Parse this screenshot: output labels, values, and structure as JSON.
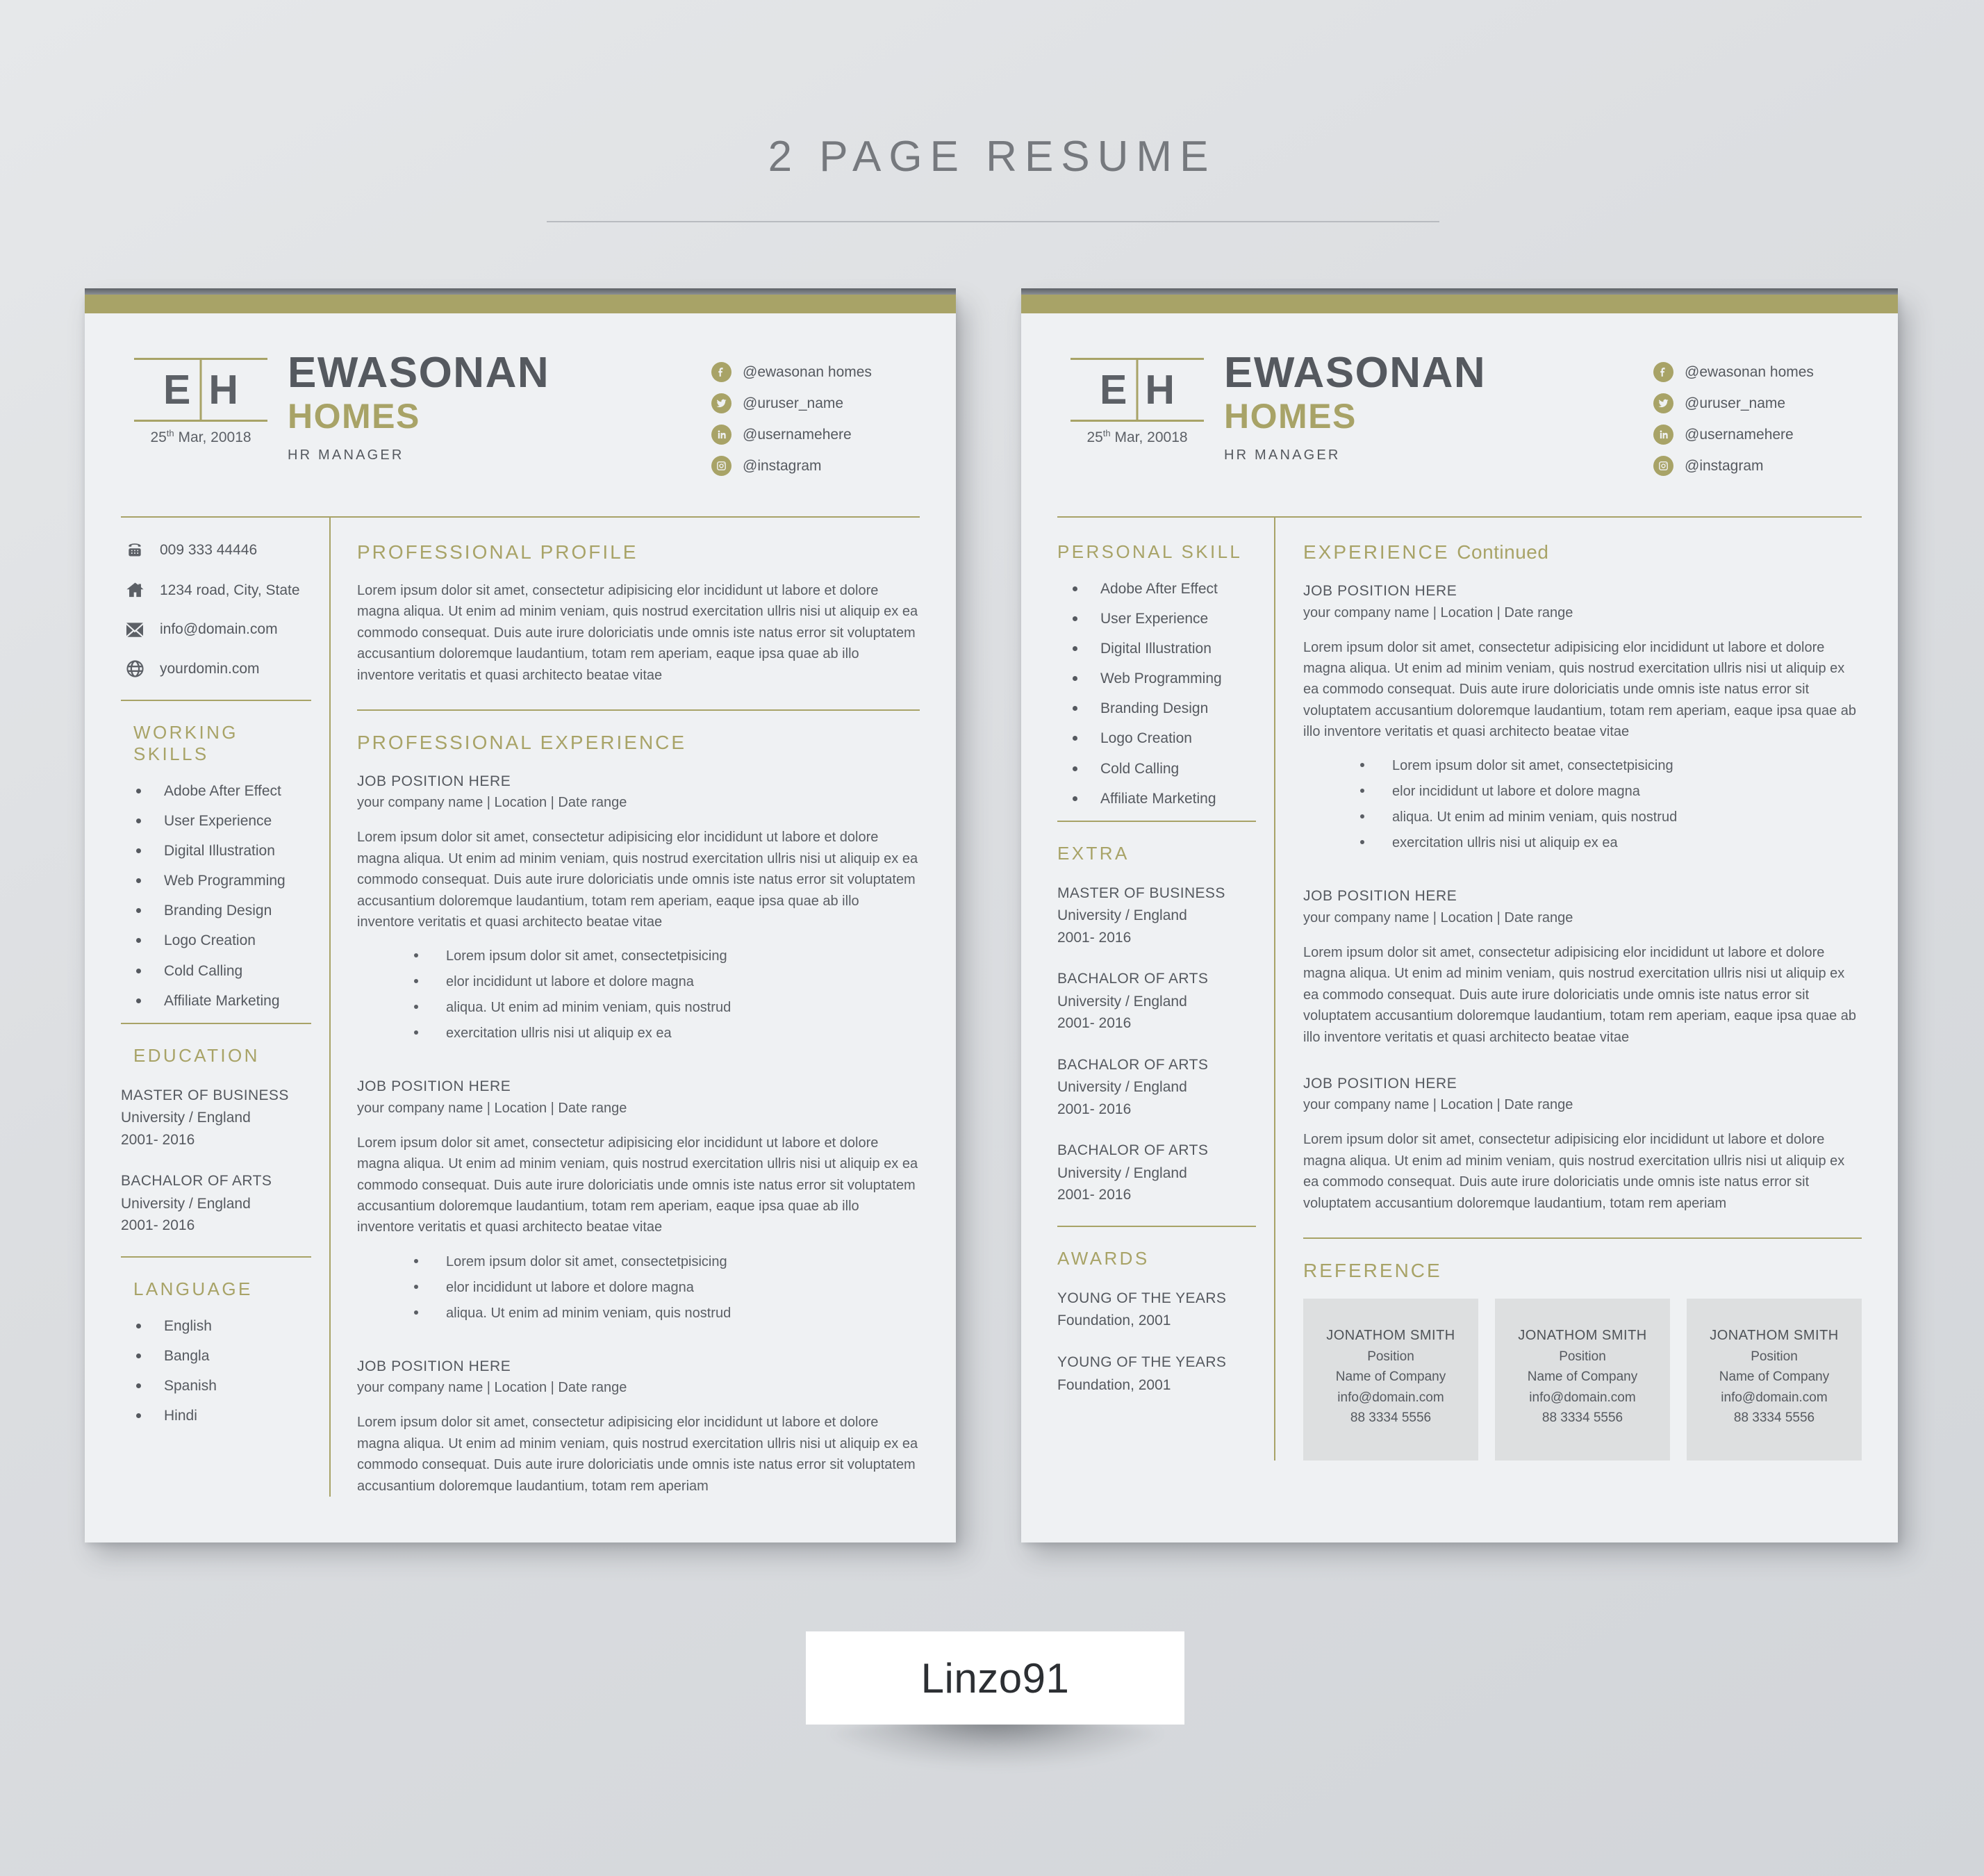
{
  "header": {
    "title": "2 PAGE RESUME"
  },
  "badge": {
    "label": "Linzo91"
  },
  "colors": {
    "accent": "#a8a367",
    "ink": "#55595f",
    "paper": "#eff1f3",
    "card": "#dddfe0"
  },
  "identity": {
    "monogram_left": "E",
    "monogram_right": "H",
    "date_day": "25",
    "date_sup": "th",
    "date_rest": " Mar, 20018",
    "first_name": "EWASONAN",
    "last_name": "HOMES",
    "role": "HR MANAGER"
  },
  "social": [
    {
      "icon": "facebook-icon",
      "handle": "@ewasonan homes"
    },
    {
      "icon": "twitter-icon",
      "handle": "@uruser_name"
    },
    {
      "icon": "linkedin-icon",
      "handle": "@usernamehere"
    },
    {
      "icon": "instagram-icon",
      "handle": "@instagram"
    }
  ],
  "contact": [
    {
      "icon": "phone-icon",
      "value": "009 333 44446"
    },
    {
      "icon": "home-icon",
      "value": "1234 road, City, State"
    },
    {
      "icon": "email-icon",
      "value": "info@domain.com"
    },
    {
      "icon": "globe-icon",
      "value": "yourdomin.com"
    }
  ],
  "page1": {
    "working_skills": {
      "heading": "WORKING SKILLS",
      "items": [
        "Adobe After Effect",
        "User Experience",
        "Digital Illustration",
        "Web Programming",
        "Branding Design",
        "Logo Creation",
        "Cold Calling",
        "Affiliate Marketing"
      ]
    },
    "education": {
      "heading": "EDUCATION",
      "items": [
        {
          "degree": "MASTER OF BUSINESS",
          "school": "University / England",
          "years": "2001- 2016"
        },
        {
          "degree": "BACHALOR OF ARTS",
          "school": "University / England",
          "years": "2001- 2016"
        }
      ]
    },
    "language": {
      "heading": "LANGUAGE",
      "items": [
        "English",
        "Bangla",
        "Spanish",
        "Hindi"
      ]
    },
    "profile": {
      "heading": "PROFESSIONAL PROFILE",
      "body": "Lorem ipsum dolor sit amet, consectetur adipisicing elor incididunt ut labore et dolore magna aliqua. Ut enim ad minim veniam, quis nostrud exercitation ullris nisi ut aliquip ex ea commodo consequat. Duis aute irure doloriciatis unde omnis iste natus error sit voluptatem accusantium doloremque laudantium, totam rem aperiam, eaque ipsa quae ab illo inventore veritatis et quasi architecto beatae vitae"
    },
    "experience": {
      "heading": "PROFESSIONAL EXPERIENCE",
      "jobs": [
        {
          "title": "JOB POSITION HERE",
          "meta": "your company name | Location | Date range",
          "body": "Lorem ipsum dolor sit amet, consectetur adipisicing elor incididunt ut labore et dolore magna aliqua. Ut enim ad minim veniam, quis nostrud exercitation ullris nisi ut aliquip ex ea commodo consequat. Duis aute irure doloriciatis unde omnis iste natus error sit voluptatem accusantium doloremque laudantium, totam rem aperiam, eaque ipsa quae ab illo inventore veritatis et quasi architecto beatae vitae",
          "bullets": [
            "Lorem ipsum dolor sit amet, consectetpisicing",
            "elor incididunt ut labore et dolore magna",
            "aliqua. Ut enim ad minim veniam, quis nostrud",
            "exercitation ullris nisi ut aliquip ex ea"
          ]
        },
        {
          "title": "JOB POSITION HERE",
          "meta": "your company name | Location | Date range",
          "body": "Lorem ipsum dolor sit amet, consectetur adipisicing elor incididunt ut labore et dolore magna aliqua. Ut enim ad minim veniam, quis nostrud exercitation ullris nisi ut aliquip ex ea commodo consequat. Duis aute irure doloriciatis unde omnis iste natus error sit voluptatem accusantium doloremque laudantium, totam rem aperiam, eaque ipsa quae ab illo inventore veritatis et quasi architecto beatae vitae",
          "bullets": [
            "Lorem ipsum dolor sit amet, consectetpisicing",
            "elor incididunt ut labore et dolore magna",
            "aliqua. Ut enim ad minim veniam, quis nostrud"
          ]
        },
        {
          "title": "JOB POSITION HERE",
          "meta": "your company name | Location | Date range",
          "body": "Lorem ipsum dolor sit amet, consectetur adipisicing elor incididunt ut labore et dolore magna aliqua. Ut enim ad minim veniam, quis nostrud exercitation ullris nisi ut aliquip ex ea commodo consequat. Duis aute irure doloriciatis unde omnis iste natus error sit voluptatem accusantium doloremque laudantium, totam rem aperiam",
          "bullets": []
        }
      ]
    }
  },
  "page2": {
    "personal_skill": {
      "heading": "PERSONAL SKILL",
      "items": [
        "Adobe After Effect",
        "User Experience",
        "Digital Illustration",
        "Web Programming",
        "Branding Design",
        "Logo Creation",
        "Cold Calling",
        "Affiliate Marketing"
      ]
    },
    "extra": {
      "heading": "EXTRA",
      "items": [
        {
          "degree": "MASTER OF BUSINESS",
          "school": "University / England",
          "years": "2001- 2016"
        },
        {
          "degree": "BACHALOR OF ARTS",
          "school": "University / England",
          "years": "2001- 2016"
        },
        {
          "degree": "BACHALOR OF ARTS",
          "school": "University / England",
          "years": "2001- 2016"
        },
        {
          "degree": "BACHALOR OF ARTS",
          "school": "University / England",
          "years": "2001- 2016"
        }
      ]
    },
    "awards": {
      "heading": "AWARDS",
      "items": [
        {
          "name": "YOUNG OF THE YEARS",
          "org": "Foundation, 2001"
        },
        {
          "name": "YOUNG OF THE YEARS",
          "org": "Foundation, 2001"
        }
      ]
    },
    "experience": {
      "heading_strong": "EXPERIENCE",
      "heading_light": "Continued",
      "jobs": [
        {
          "title": "JOB POSITION HERE",
          "meta": "your company name | Location | Date range",
          "body": "Lorem ipsum dolor sit amet, consectetur adipisicing elor incididunt ut labore et dolore magna aliqua. Ut enim ad minim veniam, quis nostrud exercitation ullris nisi ut aliquip ex ea commodo consequat. Duis aute irure doloriciatis unde omnis iste natus error sit voluptatem accusantium doloremque laudantium, totam rem aperiam, eaque ipsa quae ab illo inventore veritatis et quasi architecto beatae vitae",
          "bullets": [
            "Lorem ipsum dolor sit amet, consectetpisicing",
            "elor incididunt ut labore et dolore magna",
            "aliqua. Ut enim ad minim veniam, quis nostrud",
            "exercitation ullris nisi ut aliquip ex ea"
          ]
        },
        {
          "title": "JOB POSITION HERE",
          "meta": "your company name | Location | Date range",
          "body": "Lorem ipsum dolor sit amet, consectetur adipisicing elor incididunt ut labore et dolore magna aliqua. Ut enim ad minim veniam, quis nostrud exercitation ullris nisi ut aliquip ex ea commodo consequat. Duis aute irure doloriciatis unde omnis iste natus error sit voluptatem accusantium doloremque laudantium, totam rem aperiam, eaque ipsa quae ab illo inventore veritatis et quasi architecto beatae vitae",
          "bullets": []
        },
        {
          "title": "JOB POSITION HERE",
          "meta": "your company name | Location | Date range",
          "body": "Lorem ipsum dolor sit amet, consectetur adipisicing elor incididunt ut labore et dolore magna aliqua. Ut enim ad minim veniam, quis nostrud exercitation ullris nisi ut aliquip ex ea commodo consequat. Duis aute irure doloriciatis unde omnis iste natus error sit voluptatem accusantium doloremque laudantium, totam rem aperiam",
          "bullets": []
        }
      ]
    },
    "reference": {
      "heading": "REFERENCE",
      "cards": [
        {
          "name": "JONATHOM SMITH",
          "position": "Position",
          "company": "Name of Company",
          "email": "info@domain.com",
          "phone": "88 3334 5556"
        },
        {
          "name": "JONATHOM SMITH",
          "position": "Position",
          "company": "Name of Company",
          "email": "info@domain.com",
          "phone": "88 3334 5556"
        },
        {
          "name": "JONATHOM SMITH",
          "position": "Position",
          "company": "Name of Company",
          "email": "info@domain.com",
          "phone": "88 3334 5556"
        }
      ]
    }
  }
}
